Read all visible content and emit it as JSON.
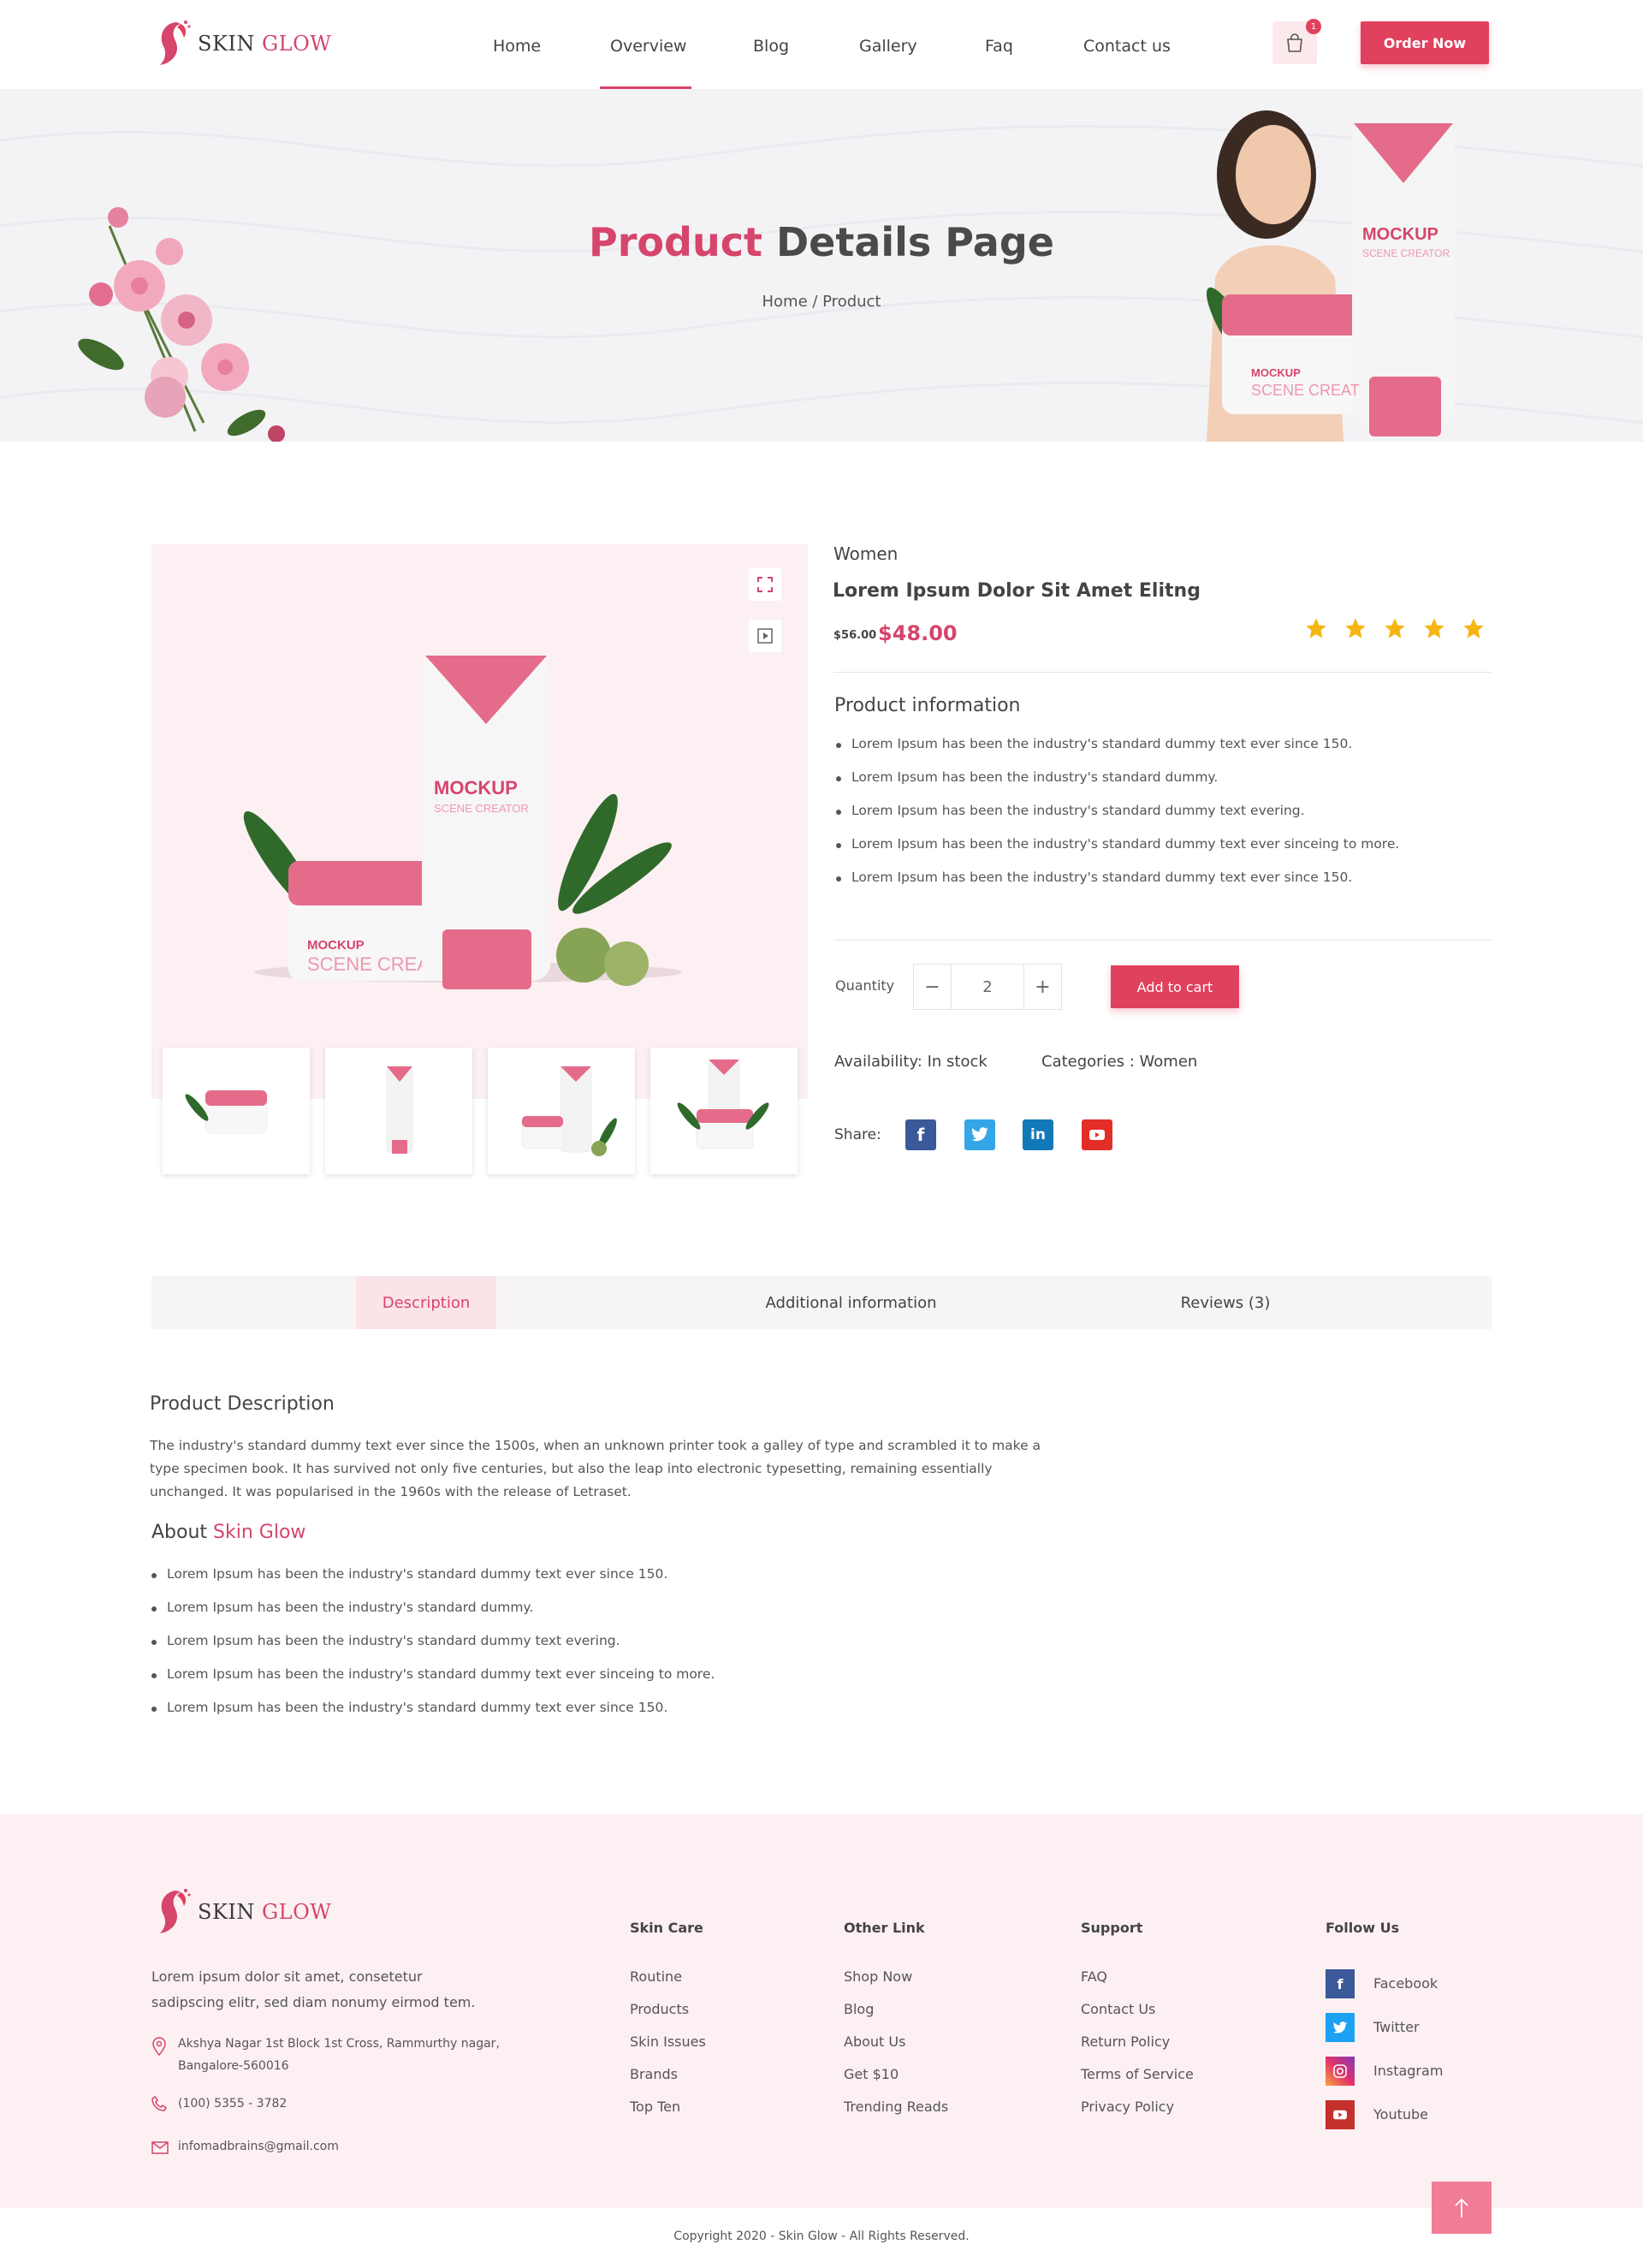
{
  "brand": {
    "name_part1": "SKIN ",
    "name_part2": "GLOW"
  },
  "nav": {
    "items": [
      "Home",
      "Overview",
      "Blog",
      "Gallery",
      "Faq",
      "Contact us"
    ],
    "active": "Overview"
  },
  "cart": {
    "count": "1"
  },
  "order_button": "Order Now",
  "banner": {
    "title_part1": "Product",
    "title_part2": " Details Page",
    "breadcrumb": "Home / Product"
  },
  "product": {
    "category": "Women",
    "title": "Lorem Ipsum Dolor Sit Amet Elitng",
    "old_price": "$56.00",
    "price": "$48.00",
    "rating": 5,
    "info_heading": "Product information",
    "info_items": [
      "Lorem Ipsum has been the industry's standard dummy text ever since 150.",
      "Lorem Ipsum has been the industry's standard dummy.",
      "Lorem Ipsum has been the industry's standard dummy text evering.",
      "Lorem Ipsum has been the industry's standard dummy text ever sinceing to more.",
      "Lorem Ipsum has been the industry's standard dummy text ever since 150."
    ],
    "quantity_label": "Quantity",
    "quantity": "2",
    "add_to_cart": "Add to cart",
    "availability": "Availability: In stock",
    "categories": "Categories : Women",
    "share_label": "Share:",
    "mockup_label": "MOCKUP",
    "mockup_sub": "SCENE CREATOR"
  },
  "tabs": {
    "items": [
      "Description",
      "Additional information",
      "Reviews (3)"
    ],
    "active": "Description"
  },
  "description": {
    "heading": "Product Description",
    "text": "The industry's standard dummy text ever since the 1500s, when an unknown printer took a galley of type and scrambled it to make a type specimen book. It has survived not only five centuries, but also the leap into electronic typesetting, remaining essentially unchanged. It was popularised in the 1960s with the release of Letraset.",
    "about_part1": "About ",
    "about_part2": "Skin Glow",
    "about_items": [
      "Lorem Ipsum has been the industry's standard dummy text ever since 150.",
      "Lorem Ipsum has been the industry's standard dummy.",
      "Lorem Ipsum has been the industry's standard dummy text evering.",
      "Lorem Ipsum has been the industry's standard dummy text ever sinceing to more.",
      "Lorem Ipsum has been the industry's standard dummy text ever since 150."
    ]
  },
  "footer": {
    "about_line1": "Lorem ipsum dolor sit amet, consetetur",
    "about_line2": "sadipscing elitr, sed diam nonumy eirmod tem.",
    "address_line1": "Akshya Nagar 1st Block 1st Cross, Rammurthy nagar,",
    "address_line2": "Bangalore-560016",
    "phone": "(100) 5355 - 3782",
    "email": "infomadbrains@gmail.com",
    "columns": [
      {
        "heading": "Skin Care",
        "links": [
          "Routine",
          "Products",
          "Skin Issues",
          "Brands",
          "Top Ten"
        ]
      },
      {
        "heading": "Other Link",
        "links": [
          "Shop Now",
          "Blog",
          "About Us",
          "Get $10",
          "Trending Reads"
        ]
      },
      {
        "heading": "Support",
        "links": [
          "FAQ",
          "Contact Us",
          "Return Policy",
          "Terms of Service",
          "Privacy Policy"
        ]
      }
    ],
    "follow_heading": "Follow Us",
    "social": [
      "Facebook",
      "Twitter",
      "Instagram",
      "Youtube"
    ],
    "copyright": "Copyright 2020 - Skin Glow - All Rights Reserved."
  },
  "colors": {
    "accent": "#e0415d",
    "brand_pink": "#d6456b",
    "soft_pink": "#fcf0f3",
    "banner_bg": "#f3f3f6",
    "star": "#f6b511"
  },
  "icons": [
    "cart-icon",
    "expand-icon",
    "play-icon",
    "star-icon",
    "facebook-icon",
    "twitter-icon",
    "linkedin-icon",
    "youtube-icon",
    "location-icon",
    "phone-icon",
    "mail-icon",
    "instagram-icon",
    "arrow-up-icon"
  ]
}
